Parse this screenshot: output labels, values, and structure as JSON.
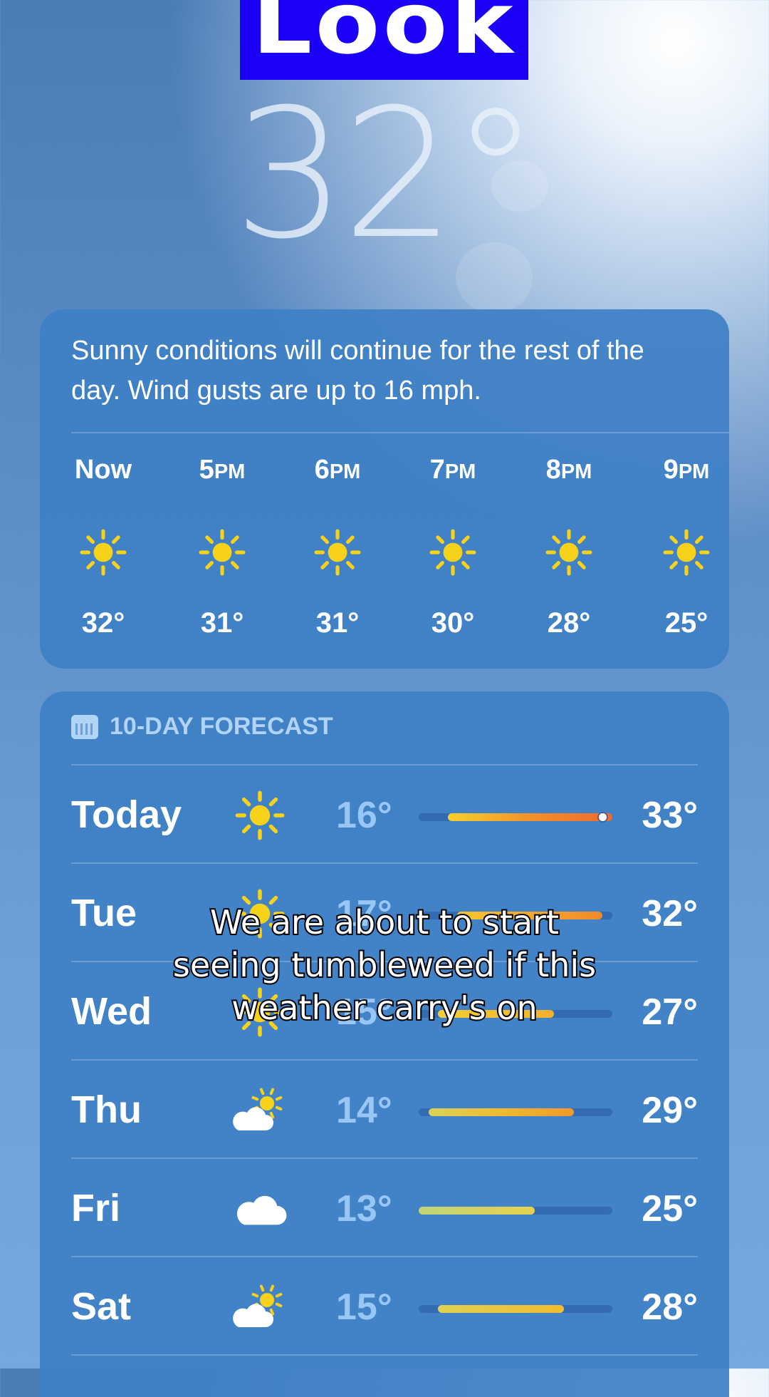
{
  "banner": {
    "text": "Look"
  },
  "current": {
    "temperature": "32°"
  },
  "summary": "Sunny conditions will continue for the rest of the day. Wind gusts are up to 16 mph.",
  "hourly": [
    {
      "label": "Now",
      "suffix": "",
      "icon": "sun-icon",
      "temp": "32°"
    },
    {
      "label": "5",
      "suffix": "PM",
      "icon": "sun-icon",
      "temp": "31°"
    },
    {
      "label": "6",
      "suffix": "PM",
      "icon": "sun-icon",
      "temp": "31°"
    },
    {
      "label": "7",
      "suffix": "PM",
      "icon": "sun-icon",
      "temp": "30°"
    },
    {
      "label": "8",
      "suffix": "PM",
      "icon": "sun-icon",
      "temp": "28°"
    },
    {
      "label": "9",
      "suffix": "PM",
      "icon": "sun-icon",
      "temp": "25°"
    }
  ],
  "forecast": {
    "title": "10-DAY FORECAST",
    "icon": "calendar-icon",
    "range": [
      13,
      33
    ],
    "days": [
      {
        "day": "Today",
        "icon": "sun-icon",
        "low": "16°",
        "high": "33°",
        "lo": 16,
        "hi": 33,
        "current": 32,
        "colors": [
          "#f5d12e",
          "#f3902a",
          "#ee6a2c"
        ]
      },
      {
        "day": "Tue",
        "icon": "sun-icon",
        "low": "17°",
        "high": "32°",
        "lo": 17,
        "hi": 32,
        "colors": [
          "#f7c631",
          "#f08a2a"
        ]
      },
      {
        "day": "Wed",
        "icon": "sun-icon",
        "low": "15°",
        "high": "27°",
        "lo": 15,
        "hi": 27,
        "colors": [
          "#f2cf35",
          "#f2b12e"
        ]
      },
      {
        "day": "Thu",
        "icon": "partly-cloudy-icon",
        "low": "14°",
        "high": "29°",
        "lo": 14,
        "hi": 29,
        "colors": [
          "#d7d35b",
          "#f3ba2f",
          "#f3992c"
        ]
      },
      {
        "day": "Fri",
        "icon": "cloud-icon",
        "low": "13°",
        "high": "25°",
        "lo": 13,
        "hi": 25,
        "colors": [
          "#bfd57a",
          "#e6d14c"
        ]
      },
      {
        "day": "Sat",
        "icon": "partly-cloudy-icon",
        "low": "15°",
        "high": "28°",
        "lo": 15,
        "hi": 28,
        "colors": [
          "#e0d152",
          "#f2bb30"
        ]
      }
    ]
  },
  "caption": {
    "line1": "We are about to start",
    "line2": "seeing tumbleweed if this",
    "line3": "weather carry's on"
  },
  "colors": {
    "sun": "#f7d21b",
    "card": "#3e80c5",
    "banner": "#1a00f4"
  }
}
